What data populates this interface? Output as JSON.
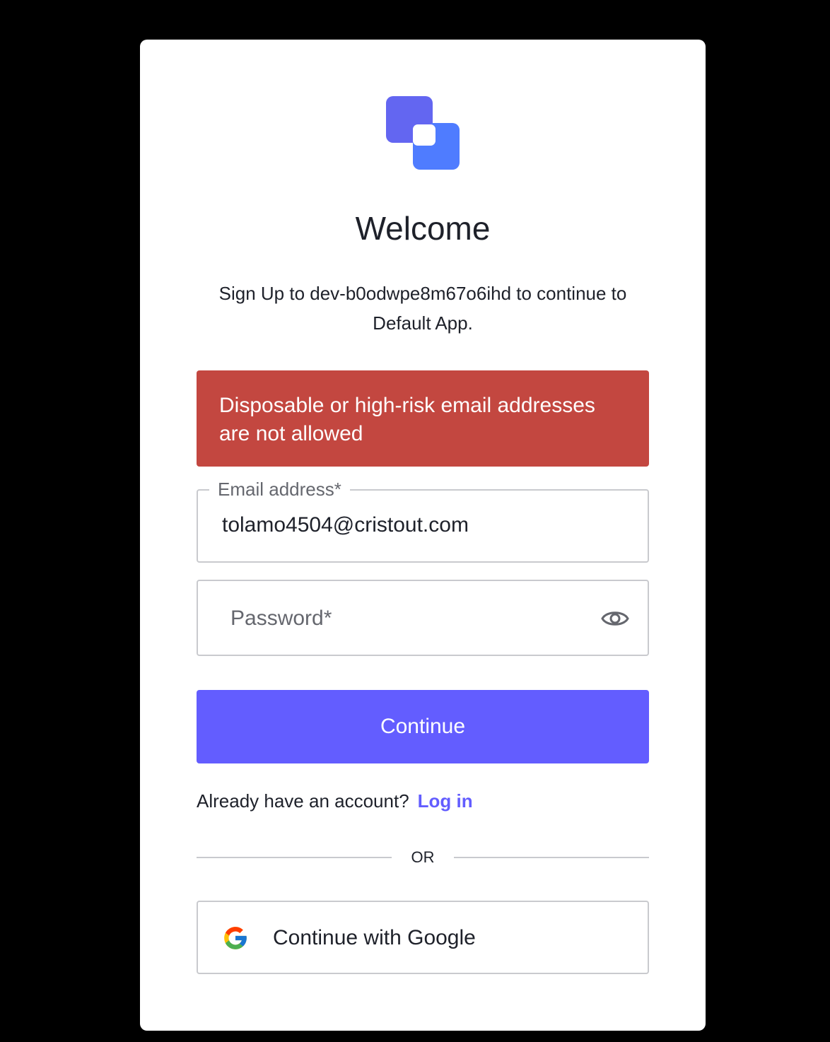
{
  "header": {
    "title": "Welcome",
    "subtitle": "Sign Up to dev-b0odwpe8m67o6ihd to continue to Default App."
  },
  "error": {
    "message": "Disposable or high-risk email addresses are not allowed"
  },
  "form": {
    "email_label": "Email address*",
    "email_value": "tolamo4504@cristout.com",
    "password_placeholder": "Password*",
    "continue_label": "Continue"
  },
  "footer": {
    "account_prompt": "Already have an account?",
    "login_label": "Log in",
    "or_label": "OR",
    "google_label": "Continue with Google"
  },
  "colors": {
    "brand": "#635dff",
    "error_bg": "#c34740",
    "logo_primary": "#6366f1",
    "logo_secondary": "#4f7cff"
  },
  "icons": {
    "logo": "app-logo",
    "password_toggle": "eye-icon",
    "google": "google-icon"
  }
}
